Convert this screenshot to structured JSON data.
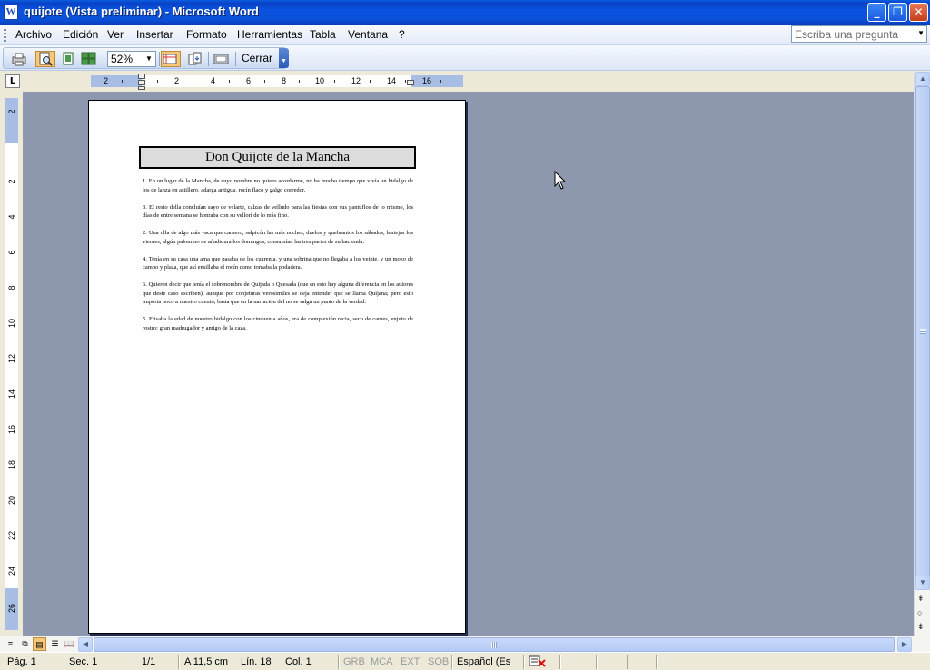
{
  "window": {
    "title": "quijote (Vista preliminar) - Microsoft Word",
    "minimize_icon": "minimize-icon",
    "restore_icon": "restore-icon",
    "close_icon": "close-icon"
  },
  "menu": {
    "items": [
      "Archivo",
      "Edición",
      "Ver",
      "Insertar",
      "Formato",
      "Herramientas",
      "Tabla",
      "Ventana",
      "?"
    ],
    "help_placeholder": "Escriba una pregunta"
  },
  "toolbar": {
    "zoom_value": "52%",
    "close_label": "Cerrar",
    "icons": [
      "print-icon",
      "magnifier-icon",
      "one-page-icon",
      "multiple-pages-icon",
      "view-ruler-icon",
      "shrink-to-fit-icon",
      "full-screen-icon"
    ]
  },
  "ruler": {
    "horizontal_labels": [
      "2",
      "2",
      "4",
      "6",
      "8",
      "10",
      "12",
      "14",
      "16"
    ],
    "vertical_labels": [
      "2",
      "2",
      "4",
      "6",
      "8",
      "10",
      "12",
      "14",
      "16",
      "18",
      "20",
      "22",
      "24",
      "26"
    ]
  },
  "document": {
    "title": "Don Quijote de la Mancha",
    "paragraphs": [
      "1. En un lugar de la Mancha, de cuyo nombre no quiero acordarme, no ha mucho tiempo que vivía un hidalgo de los de lanza en astillero, adarga antigua, rocín flaco y galgo corredor.",
      "3. El resto della concluían sayo de velarte, calzas de velludo para las fiestas con sus pantuflos de lo mismo, los días de entre semana se honraba con su vellorí de lo más fino.",
      "2. Una olla de algo más vaca que carnero, salpicón las más noches, duelos y quebrantos los sábados, lentejas los viernes, algún palomino de añadidura los domingos, consumían las tres partes de su hacienda.",
      "4. Tenía en su casa una ama que pasaba de los cuarenta, y una sobrina que no llegaba a los veinte, y un mozo de campo y plaza, que así ensillaba el rocín como tomaba la podadera.",
      "6. Quieren decir que tenía el sobrenombre de Quijada o Quesada (que en esto hay alguna diferencia en los autores que deste caso escriben), aunque por conjeturas verosímiles se deja entender que se llama Quijana; pero esto importa poco a nuestro cuento; basta que en la narración dél no se salga un punto de la verdad.",
      "5. Frisaba la edad de nuestro hidalgo con los cincuenta años, era de complexión recia, seco de carnes, enjuto de rostro; gran madrugador y amigo de la caza."
    ]
  },
  "statusbar": {
    "page": "Pág. 1",
    "section": "Sec. 1",
    "page_of": "1/1",
    "at": "A 11,5 cm",
    "line": "Lín. 18",
    "column": "Col. 1",
    "grb": "GRB",
    "mca": "MCA",
    "ext": "EXT",
    "sob": "SOB",
    "language": "Español (Es"
  }
}
